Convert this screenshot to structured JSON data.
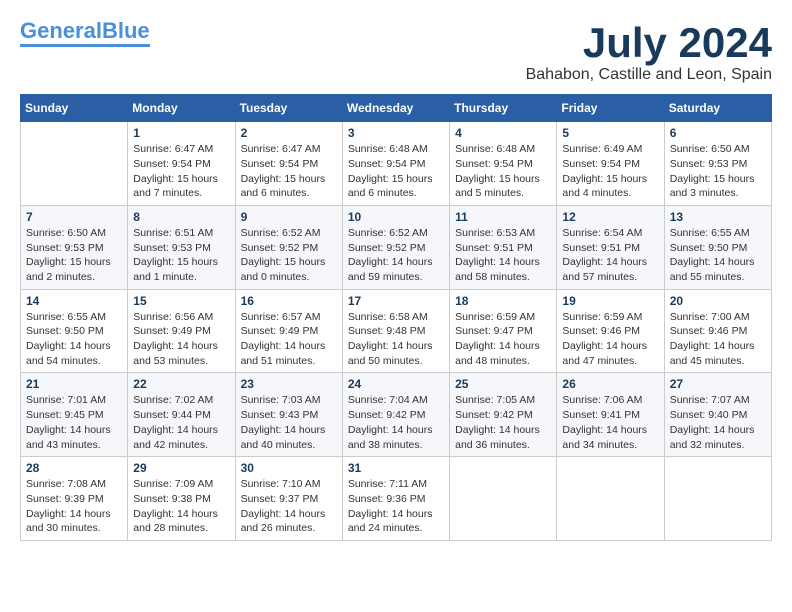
{
  "logo": {
    "line1": "General",
    "line2": "Blue"
  },
  "title": {
    "month_year": "July 2024",
    "location": "Bahabon, Castille and Leon, Spain"
  },
  "weekdays": [
    "Sunday",
    "Monday",
    "Tuesday",
    "Wednesday",
    "Thursday",
    "Friday",
    "Saturday"
  ],
  "weeks": [
    [
      {
        "day": "",
        "info": ""
      },
      {
        "day": "1",
        "info": "Sunrise: 6:47 AM\nSunset: 9:54 PM\nDaylight: 15 hours\nand 7 minutes."
      },
      {
        "day": "2",
        "info": "Sunrise: 6:47 AM\nSunset: 9:54 PM\nDaylight: 15 hours\nand 6 minutes."
      },
      {
        "day": "3",
        "info": "Sunrise: 6:48 AM\nSunset: 9:54 PM\nDaylight: 15 hours\nand 6 minutes."
      },
      {
        "day": "4",
        "info": "Sunrise: 6:48 AM\nSunset: 9:54 PM\nDaylight: 15 hours\nand 5 minutes."
      },
      {
        "day": "5",
        "info": "Sunrise: 6:49 AM\nSunset: 9:54 PM\nDaylight: 15 hours\nand 4 minutes."
      },
      {
        "day": "6",
        "info": "Sunrise: 6:50 AM\nSunset: 9:53 PM\nDaylight: 15 hours\nand 3 minutes."
      }
    ],
    [
      {
        "day": "7",
        "info": "Sunrise: 6:50 AM\nSunset: 9:53 PM\nDaylight: 15 hours\nand 2 minutes."
      },
      {
        "day": "8",
        "info": "Sunrise: 6:51 AM\nSunset: 9:53 PM\nDaylight: 15 hours\nand 1 minute."
      },
      {
        "day": "9",
        "info": "Sunrise: 6:52 AM\nSunset: 9:52 PM\nDaylight: 15 hours\nand 0 minutes."
      },
      {
        "day": "10",
        "info": "Sunrise: 6:52 AM\nSunset: 9:52 PM\nDaylight: 14 hours\nand 59 minutes."
      },
      {
        "day": "11",
        "info": "Sunrise: 6:53 AM\nSunset: 9:51 PM\nDaylight: 14 hours\nand 58 minutes."
      },
      {
        "day": "12",
        "info": "Sunrise: 6:54 AM\nSunset: 9:51 PM\nDaylight: 14 hours\nand 57 minutes."
      },
      {
        "day": "13",
        "info": "Sunrise: 6:55 AM\nSunset: 9:50 PM\nDaylight: 14 hours\nand 55 minutes."
      }
    ],
    [
      {
        "day": "14",
        "info": "Sunrise: 6:55 AM\nSunset: 9:50 PM\nDaylight: 14 hours\nand 54 minutes."
      },
      {
        "day": "15",
        "info": "Sunrise: 6:56 AM\nSunset: 9:49 PM\nDaylight: 14 hours\nand 53 minutes."
      },
      {
        "day": "16",
        "info": "Sunrise: 6:57 AM\nSunset: 9:49 PM\nDaylight: 14 hours\nand 51 minutes."
      },
      {
        "day": "17",
        "info": "Sunrise: 6:58 AM\nSunset: 9:48 PM\nDaylight: 14 hours\nand 50 minutes."
      },
      {
        "day": "18",
        "info": "Sunrise: 6:59 AM\nSunset: 9:47 PM\nDaylight: 14 hours\nand 48 minutes."
      },
      {
        "day": "19",
        "info": "Sunrise: 6:59 AM\nSunset: 9:46 PM\nDaylight: 14 hours\nand 47 minutes."
      },
      {
        "day": "20",
        "info": "Sunrise: 7:00 AM\nSunset: 9:46 PM\nDaylight: 14 hours\nand 45 minutes."
      }
    ],
    [
      {
        "day": "21",
        "info": "Sunrise: 7:01 AM\nSunset: 9:45 PM\nDaylight: 14 hours\nand 43 minutes."
      },
      {
        "day": "22",
        "info": "Sunrise: 7:02 AM\nSunset: 9:44 PM\nDaylight: 14 hours\nand 42 minutes."
      },
      {
        "day": "23",
        "info": "Sunrise: 7:03 AM\nSunset: 9:43 PM\nDaylight: 14 hours\nand 40 minutes."
      },
      {
        "day": "24",
        "info": "Sunrise: 7:04 AM\nSunset: 9:42 PM\nDaylight: 14 hours\nand 38 minutes."
      },
      {
        "day": "25",
        "info": "Sunrise: 7:05 AM\nSunset: 9:42 PM\nDaylight: 14 hours\nand 36 minutes."
      },
      {
        "day": "26",
        "info": "Sunrise: 7:06 AM\nSunset: 9:41 PM\nDaylight: 14 hours\nand 34 minutes."
      },
      {
        "day": "27",
        "info": "Sunrise: 7:07 AM\nSunset: 9:40 PM\nDaylight: 14 hours\nand 32 minutes."
      }
    ],
    [
      {
        "day": "28",
        "info": "Sunrise: 7:08 AM\nSunset: 9:39 PM\nDaylight: 14 hours\nand 30 minutes."
      },
      {
        "day": "29",
        "info": "Sunrise: 7:09 AM\nSunset: 9:38 PM\nDaylight: 14 hours\nand 28 minutes."
      },
      {
        "day": "30",
        "info": "Sunrise: 7:10 AM\nSunset: 9:37 PM\nDaylight: 14 hours\nand 26 minutes."
      },
      {
        "day": "31",
        "info": "Sunrise: 7:11 AM\nSunset: 9:36 PM\nDaylight: 14 hours\nand 24 minutes."
      },
      {
        "day": "",
        "info": ""
      },
      {
        "day": "",
        "info": ""
      },
      {
        "day": "",
        "info": ""
      }
    ]
  ]
}
